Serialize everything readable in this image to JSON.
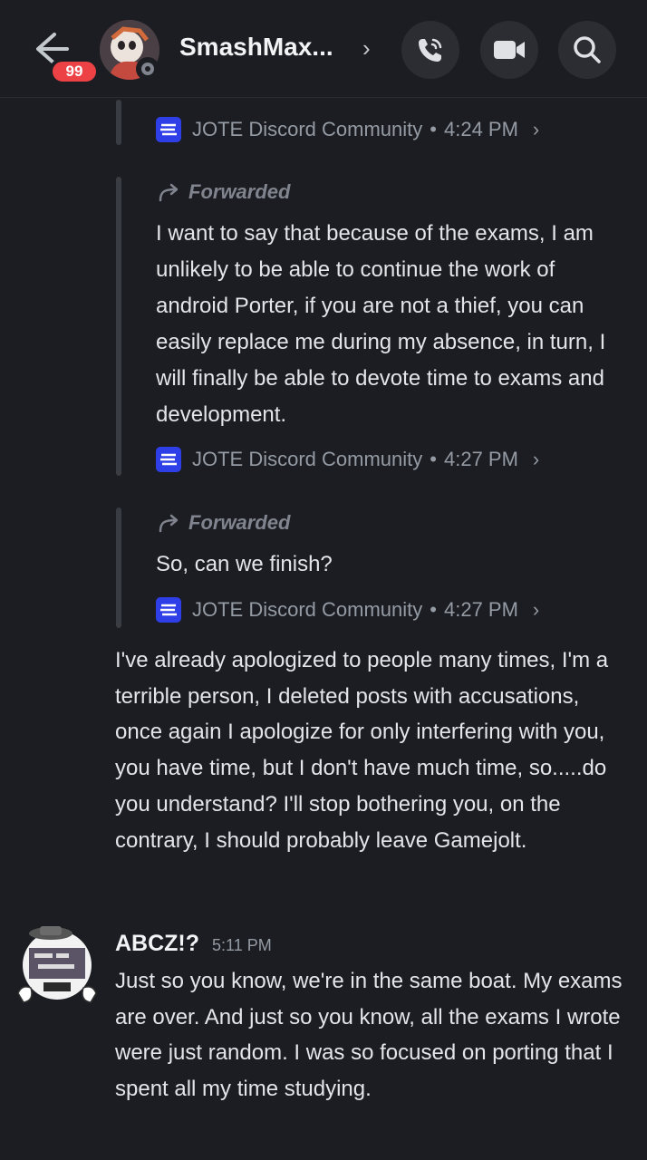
{
  "header": {
    "unread_badge": "99",
    "contact_name": "SmashMax...",
    "icons": {
      "back": "arrow-left-icon",
      "call": "phone-call-icon",
      "video": "video-camera-icon",
      "search": "search-icon",
      "expand": "chevron-right-icon"
    }
  },
  "messages": {
    "source_top": {
      "server": "JOTE Discord Community",
      "time": "4:24 PM"
    },
    "forward1": {
      "label": "Forwarded",
      "text": "I want to say that because of the exams, I am unlikely to be able to continue the work of android Porter, if you are not a thief, you can easily replace me during my absence, in turn, I will finally be able to devote time to exams and development.",
      "server": "JOTE Discord Community",
      "time": "4:27 PM"
    },
    "forward2": {
      "label": "Forwarded",
      "text": "So, can we finish?",
      "server": "JOTE Discord Community",
      "time": "4:27 PM"
    },
    "reply_text": "I've already apologized to people many times, I'm a terrible person, I deleted posts with accusations, once again I apologize for only interfering with you, you have time, but I don't have much time, so.....do you understand? I'll stop bothering you, on the contrary, I should probably leave Gamejolt.",
    "abcz": {
      "author": "ABCZ!?",
      "time": "5:11 PM",
      "text": "Just so you know, we're in the same boat. My exams are over. And just so you know, all the exams I wrote were just random. I was so focused on porting that I spent all my time studying."
    },
    "separator": "•",
    "source_arrow": "›"
  },
  "colors": {
    "background": "#1c1d22",
    "badge": "#ed4245",
    "server_logo": "#2f3fe8",
    "muted_text": "#949ba4"
  }
}
